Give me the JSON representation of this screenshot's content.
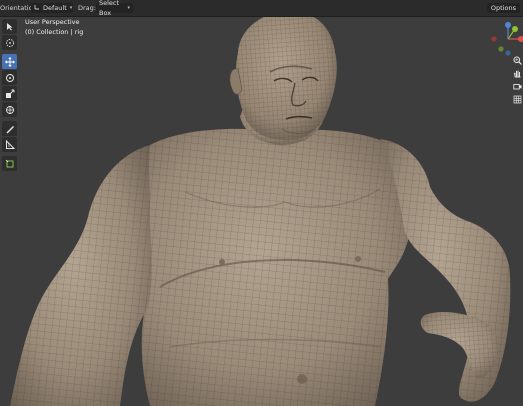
{
  "header": {
    "orientation_label": "Orientation:",
    "orientation_value": "Default",
    "drag_label": "Drag:",
    "drag_value": "Select Box",
    "options_label": "Options"
  },
  "viewport": {
    "view_name": "User Perspective",
    "collection_info": "(0) Collection | rig"
  },
  "toolbar": {
    "tools": [
      "select-box",
      "cursor",
      "move",
      "rotate",
      "scale",
      "transform",
      "annotate",
      "measure",
      "add-cube"
    ],
    "active_tool": "move"
  },
  "gizmo": {
    "axis_colors": {
      "x": "#e0504e",
      "y": "#8ec134",
      "z": "#4d87d6"
    }
  },
  "colors": {
    "viewport_bg": "#3d3d3d",
    "header_bg": "#2b2b2b",
    "skin": "#9a8a78",
    "accent": "#4772b3"
  }
}
